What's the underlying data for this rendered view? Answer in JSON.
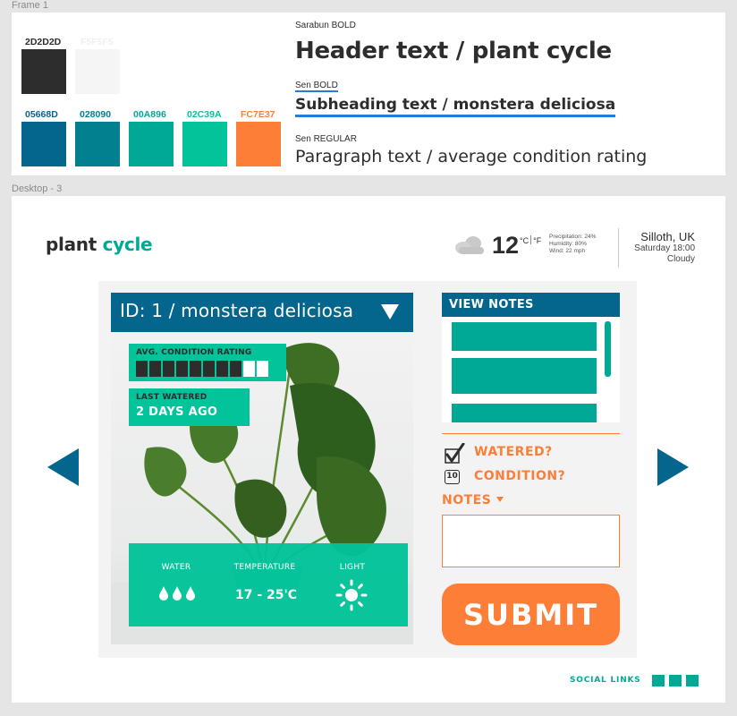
{
  "frames": {
    "frame1_label": "Frame 1",
    "desktop_label": "Desktop - 3"
  },
  "style_guide": {
    "swatches": [
      {
        "hex": "2D2D2D",
        "color": "#2D2D2D",
        "label_color": "#2D2D2D"
      },
      {
        "hex": "F5F5F5",
        "color": "#F5F5F5",
        "label_color": "#F0F0F0"
      },
      {
        "hex": "05668D",
        "color": "#05668D",
        "label_color": "#05668D"
      },
      {
        "hex": "028090",
        "color": "#028090",
        "label_color": "#028090"
      },
      {
        "hex": "00A896",
        "color": "#00A896",
        "label_color": "#00A896"
      },
      {
        "hex": "02C39A",
        "color": "#02C39A",
        "label_color": "#02C39A"
      },
      {
        "hex": "FC7E37",
        "color": "#FC7E37",
        "label_color": "#FC7E37"
      }
    ],
    "header_font_label": "Sarabun BOLD",
    "header_sample": "Header text / plant cycle",
    "sub_font_label": "Sen BOLD",
    "sub_sample": "Subheading text / monstera deliciosa",
    "para_font_label": "Sen REGULAR",
    "para_sample": "Paragraph text / average condition rating"
  },
  "app": {
    "logo_part1": "plant ",
    "logo_part2": "cycle",
    "weather": {
      "icon": "cloud-icon",
      "temperature": "12",
      "unit_c": "°C",
      "unit_f": "°F",
      "precipitation": "Precipitation: 24%",
      "humidity": "Humidity: 80%",
      "wind": "Wind: 22 mph",
      "location": "Silloth, UK",
      "datetime": "Saturday 18:00",
      "condition": "Cloudy"
    },
    "plant": {
      "title": "ID: 1 / monstera deliciosa",
      "rating_label": "AVG. CONDITION RATING",
      "rating_value": 8,
      "rating_max": 10,
      "watered_label": "LAST WATERED",
      "watered_value": "2 DAYS AGO",
      "care": {
        "water_label": "WATER",
        "water_icon": "water-drops-icon",
        "temperature_label": "TEMPERATURE",
        "temperature_value": "17 - 25'C",
        "light_label": "LIGHT",
        "light_icon": "sun-icon"
      }
    },
    "notes": {
      "view_label": "VIEW NOTES",
      "watered_label": "WATERED?",
      "watered_checked": true,
      "condition_value": "10",
      "condition_label": "CONDITION?",
      "notes_toggle": "NOTES",
      "notes_value": "",
      "submit_label": "SUBMIT"
    },
    "footer": {
      "social_label": "SOCIAL LINKS"
    }
  },
  "colors": {
    "dark": "#2D2D2D",
    "light": "#F5F5F5",
    "navy": "#05668D",
    "teal_dark": "#028090",
    "teal": "#00A896",
    "mint": "#02C39A",
    "orange": "#FC7E37"
  }
}
